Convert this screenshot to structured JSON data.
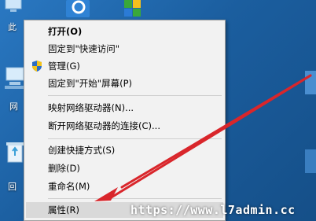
{
  "desktop": {
    "icons": [
      {
        "name": "this-pc",
        "label": "此"
      },
      {
        "name": "network",
        "label": "网"
      },
      {
        "name": "recycle-bin",
        "label": "回"
      }
    ]
  },
  "context_menu": {
    "items": [
      {
        "label": "打开(O)"
      },
      {
        "label": "固定到\"快速访问\""
      },
      {
        "label": "管理(G)"
      },
      {
        "label": "固定到\"开始\"屏幕(P)"
      },
      {
        "label": "映射网络驱动器(N)..."
      },
      {
        "label": "断开网络驱动器的连接(C)..."
      },
      {
        "label": "创建快捷方式(S)"
      },
      {
        "label": "删除(D)"
      },
      {
        "label": "重命名(M)"
      },
      {
        "label": "属性(R)"
      }
    ]
  },
  "watermark": "https://www.l7admin.cc",
  "colors": {
    "arrow": "#d9262b",
    "highlight": "#d9d9d9",
    "menu_bg": "#f2f2f2"
  }
}
